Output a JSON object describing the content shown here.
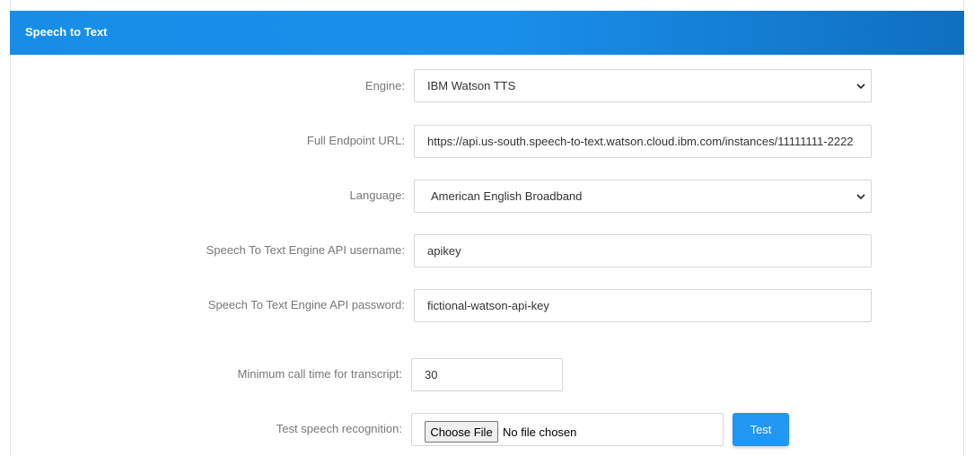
{
  "header": {
    "title": "Speech to Text"
  },
  "form": {
    "engine": {
      "label": "Engine:",
      "value": "IBM Watson TTS"
    },
    "endpoint": {
      "label": "Full Endpoint URL:",
      "value": "https://api.us-south.speech-to-text.watson.cloud.ibm.com/instances/11111111-2222"
    },
    "language": {
      "label": "Language:",
      "value": "American English Broadband"
    },
    "username": {
      "label": "Speech To Text Engine API username:",
      "value": "apikey"
    },
    "password": {
      "label": "Speech To Text Engine API password:",
      "value": "fictional-watson-api-key"
    },
    "min_call_time": {
      "label": "Minimum call time for transcript:",
      "value": "30"
    },
    "test_recognition": {
      "label": "Test speech recognition:",
      "file_button": "Choose File",
      "file_status": "No file chosen",
      "test_button": "Test"
    }
  },
  "colors": {
    "header_bg": "#1a90ec",
    "test_button": "#2196f3"
  }
}
